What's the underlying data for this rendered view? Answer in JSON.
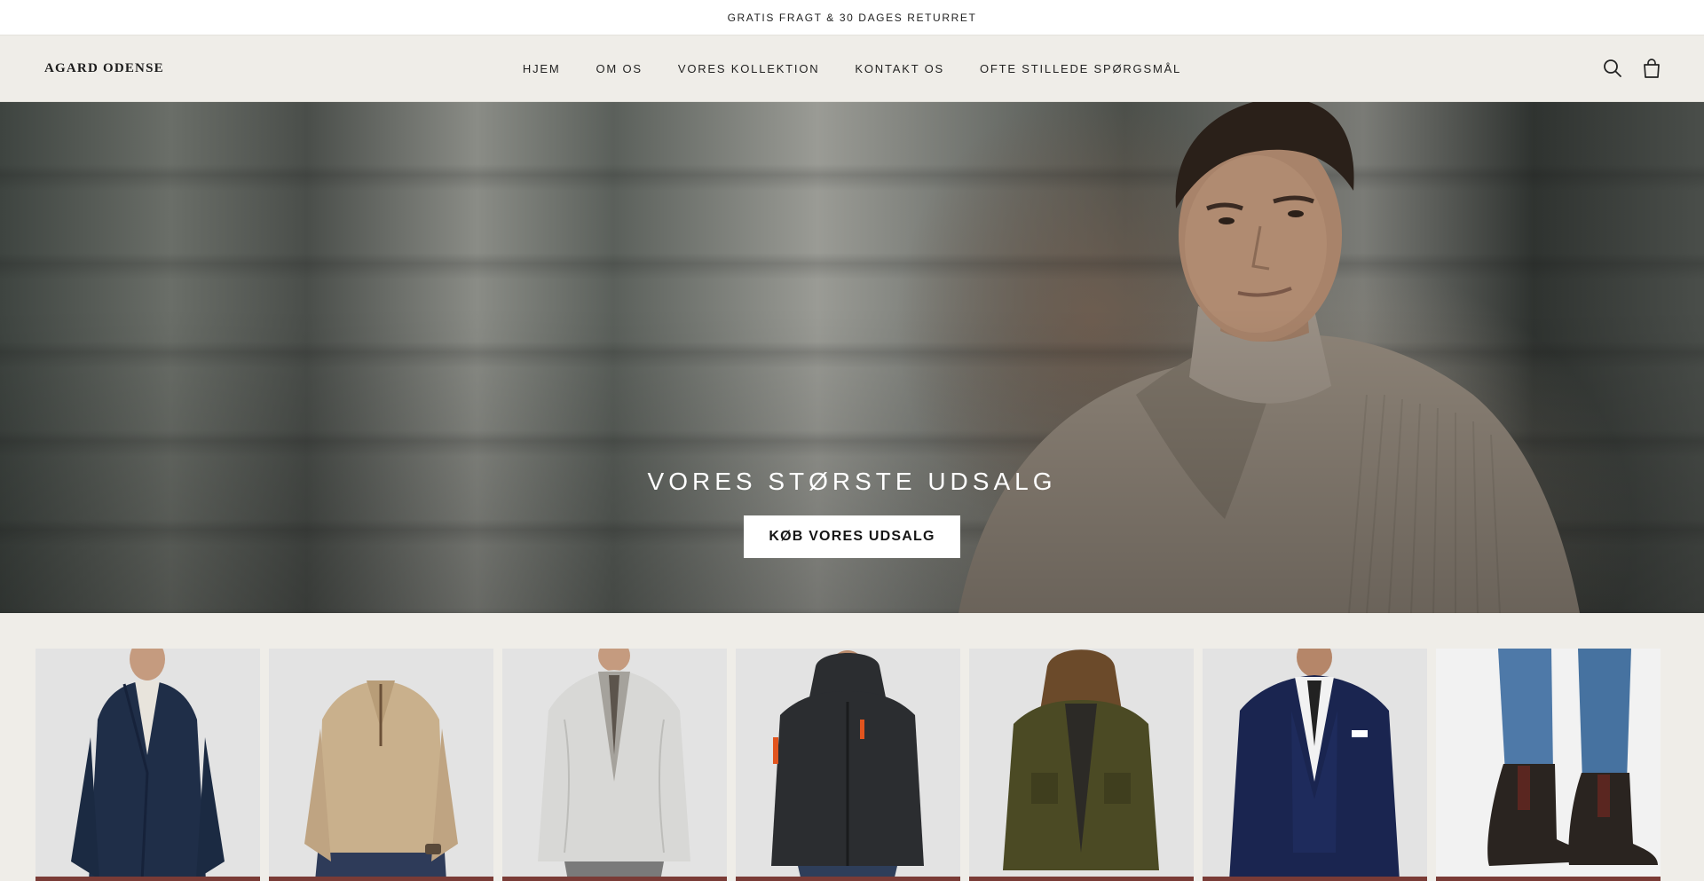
{
  "announcement": "GRATIS FRAGT & 30 DAGES RETURRET",
  "brand": "AGARD ODENSE",
  "nav": [
    {
      "label": "HJEM"
    },
    {
      "label": "OM OS"
    },
    {
      "label": "VORES KOLLEKTION"
    },
    {
      "label": "KONTAKT OS"
    },
    {
      "label": "OFTE STILLEDE SPØRGSMÅL"
    }
  ],
  "header_icons": [
    "search-icon",
    "bag-icon"
  ],
  "hero": {
    "title": "VORES STØRSTE UDSALG",
    "button": "KØB VORES UDSALG"
  },
  "products": [
    {
      "name": "navy-overcoat",
      "color": "#1f2e48"
    },
    {
      "name": "beige-half-zip-sweater",
      "color": "#c9b08c"
    },
    {
      "name": "white-cable-knit-cardigan",
      "color": "#d8d8d6"
    },
    {
      "name": "black-hoodie-jacket",
      "color": "#2b2d30"
    },
    {
      "name": "olive-parka",
      "color": "#4b4a24"
    },
    {
      "name": "navy-three-piece-suit",
      "color": "#1a2550"
    },
    {
      "name": "brown-chelsea-boots",
      "color": "#2a2420"
    }
  ],
  "colors": {
    "background": "#efede8",
    "accent_bar": "#7a3b36"
  }
}
